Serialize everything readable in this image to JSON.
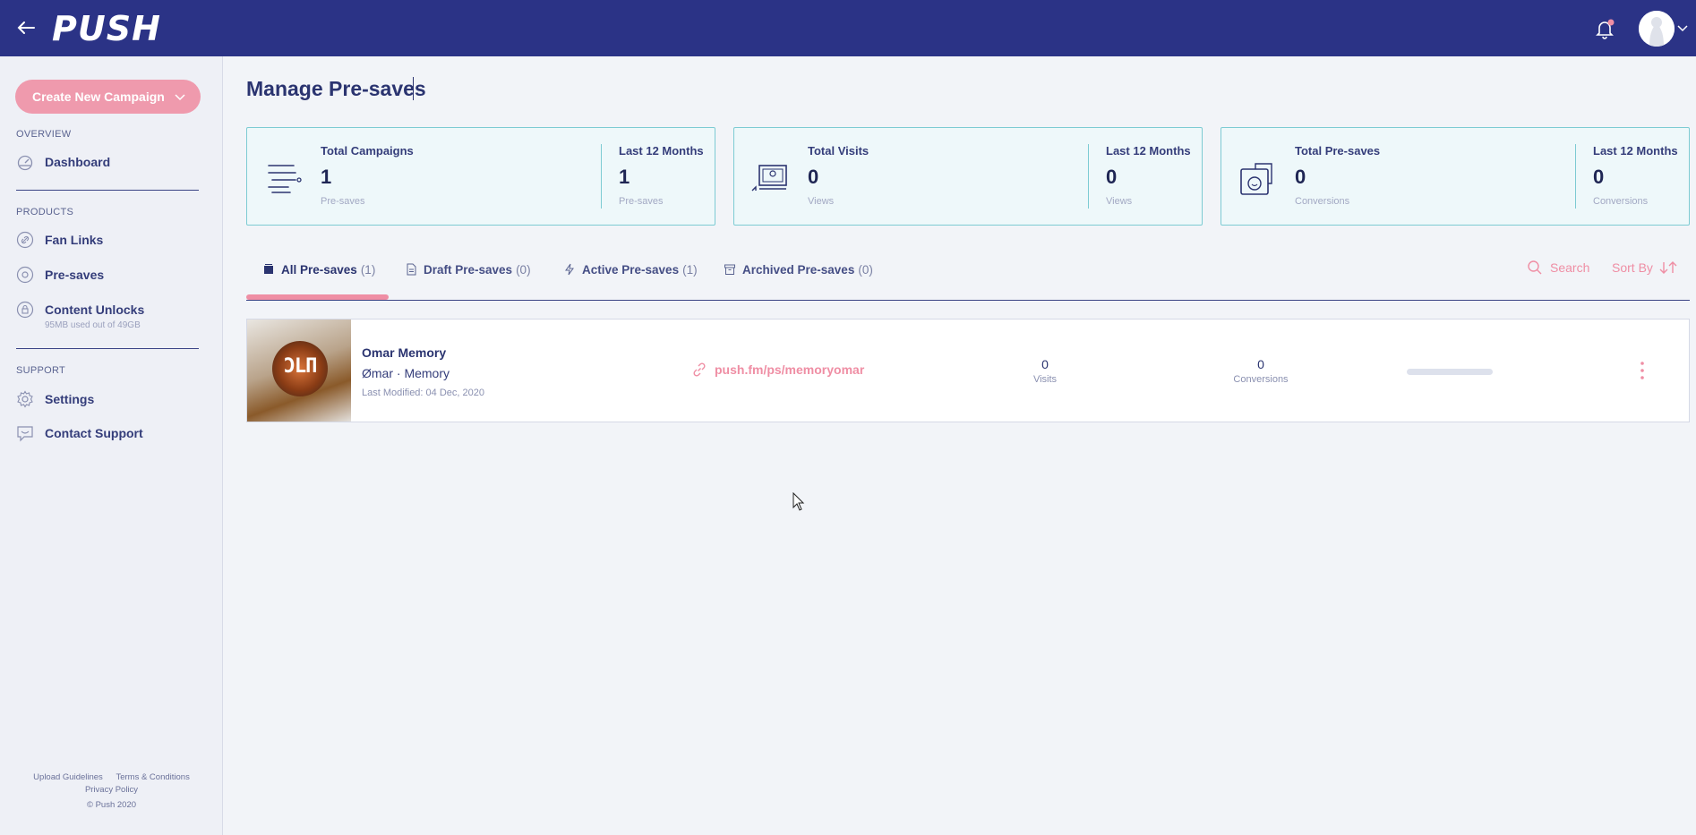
{
  "topbar": {
    "logo": "PUSH"
  },
  "sidebar": {
    "create_button": "Create New Campaign",
    "sections": {
      "overview": "OVERVIEW",
      "products": "PRODUCTS",
      "support": "SUPPORT"
    },
    "items": {
      "dashboard": "Dashboard",
      "fan_links": "Fan Links",
      "pre_saves": "Pre-saves",
      "content_unlocks": "Content Unlocks",
      "content_unlocks_sub": "95MB used out of 49GB",
      "settings": "Settings",
      "contact_support": "Contact Support"
    },
    "footer": {
      "upload_guidelines": "Upload Guidelines",
      "terms": "Terms & Conditions",
      "privacy": "Privacy Policy",
      "copyright": "© Push 2020"
    }
  },
  "page": {
    "title": "Manage Pre-saves"
  },
  "stats": [
    {
      "label": "Total Campaigns",
      "value": "1",
      "sub": "Pre-saves",
      "label2": "Last 12 Months",
      "value2": "1",
      "sub2": "Pre-saves"
    },
    {
      "label": "Total Visits",
      "value": "0",
      "sub": "Views",
      "label2": "Last 12 Months",
      "value2": "0",
      "sub2": "Views"
    },
    {
      "label": "Total Pre-saves",
      "value": "0",
      "sub": "Conversions",
      "label2": "Last 12 Months",
      "value2": "0",
      "sub2": "Conversions"
    }
  ],
  "tabs": [
    {
      "label": "All Pre-saves",
      "count": "(1)"
    },
    {
      "label": "Draft Pre-saves",
      "count": "(0)"
    },
    {
      "label": "Active Pre-saves",
      "count": "(1)"
    },
    {
      "label": "Archived Pre-saves",
      "count": "(0)"
    }
  ],
  "toolbar": {
    "search": "Search",
    "sort_by": "Sort By"
  },
  "campaign": {
    "title": "Omar Memory",
    "artist": "Ømar · Memory",
    "modified": "Last Modified: 04 Dec, 2020",
    "link": "push.fm/ps/memoryomar",
    "visits": "0",
    "visits_label": "Visits",
    "conversions": "0",
    "conversions_label": "Conversions",
    "thumb_text": "ƆLΠ"
  },
  "colors": {
    "topbar": "#2b3386",
    "accent_pink": "#ef8ea4",
    "card_border": "#7dcbd3"
  }
}
